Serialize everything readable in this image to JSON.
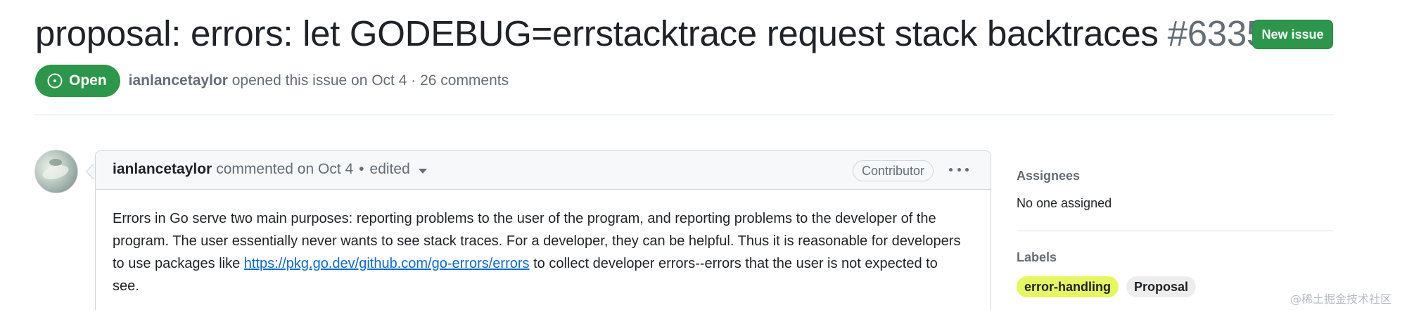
{
  "issue": {
    "title": "proposal: errors: let GODEBUG=errstacktrace request stack backtraces",
    "number": "#63358",
    "state": "Open",
    "author": "ianlancetaylor",
    "opened_text": "opened this issue on Oct 4 · 26 comments"
  },
  "header": {
    "new_issue_label": "New issue"
  },
  "comment": {
    "author": "ianlancetaylor",
    "commented_text": "commented on Oct 4",
    "dot": "•",
    "edited_text": "edited",
    "role_badge": "Contributor",
    "body_part1": "Errors in Go serve two main purposes: reporting problems to the user of the program, and reporting problems to the developer of the program. The user essentially never wants to see stack traces. For a developer, they can be helpful. Thus it is reasonable for developers to use packages like ",
    "body_link": "https://pkg.go.dev/github.com/go-errors/errors",
    "body_part2": " to collect developer errors--errors that the user is not expected to see."
  },
  "sidebar": {
    "assignees_heading": "Assignees",
    "assignees_value": "No one assigned",
    "labels_heading": "Labels",
    "labels": [
      {
        "name": "error-handling",
        "bg": "#e4f75e",
        "fg": "#1f2328"
      },
      {
        "name": "Proposal",
        "bg": "#ededed",
        "fg": "#1f2328"
      }
    ]
  },
  "colors": {
    "open_green": "#2c974b",
    "link_blue": "#0969da",
    "muted_text": "#656d76"
  },
  "icons": {
    "state": "issue-opened-icon",
    "caret": "triangle-down-icon",
    "kebab": "kebab-horizontal-icon"
  },
  "watermark": "@稀土掘金技术社区"
}
